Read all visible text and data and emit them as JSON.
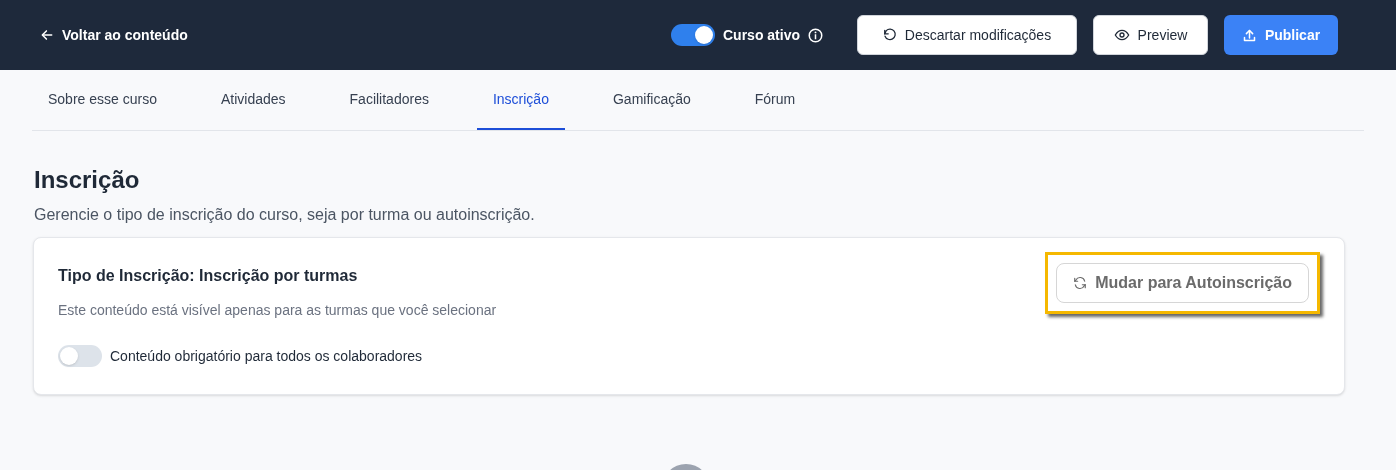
{
  "header": {
    "back_link": "Voltar ao conteúdo",
    "active_toggle": {
      "label": "Curso ativo",
      "on": true
    },
    "buttons": [
      {
        "kind": "discard",
        "label": "Descartar modificações"
      },
      {
        "kind": "preview",
        "label": "Preview"
      },
      {
        "kind": "publish",
        "label": "Publicar"
      }
    ]
  },
  "tabs": [
    {
      "label": "Sobre esse curso",
      "selected": false
    },
    {
      "label": "Atividades",
      "selected": false
    },
    {
      "label": "Facilitadores",
      "selected": false
    },
    {
      "label": "Inscrição",
      "selected": true
    },
    {
      "label": "Gamificação",
      "selected": false
    },
    {
      "label": "Fórum",
      "selected": false
    }
  ],
  "section": {
    "title": "Inscrição",
    "description": "Gerencie o tipo de inscrição do curso, seja por turma ou autoinscrição.",
    "card": {
      "title": "Tipo de Inscrição: Inscrição por turmas",
      "subtitle": "Este conteúdo está visível apenas para as turmas que você selecionar",
      "switch_button": {
        "label": "Mudar para Autoinscrição",
        "highlighted": true
      },
      "mandatory_toggle": {
        "label": "Conteúdo obrigatório para todos os colaboradores",
        "on": false
      }
    }
  }
}
